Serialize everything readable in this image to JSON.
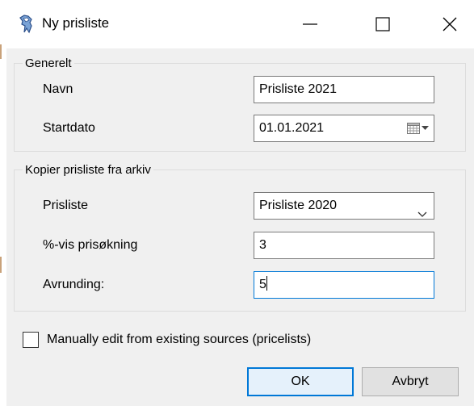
{
  "window": {
    "title": "Ny prisliste"
  },
  "general": {
    "group_title": "Generelt",
    "name_label": "Navn",
    "name_value": "Prisliste 2021",
    "startdate_label": "Startdato",
    "startdate_value": "01.01.2021"
  },
  "copy": {
    "group_title": "Kopier prisliste fra arkiv",
    "pricelist_label": "Prisliste",
    "pricelist_selected": "Prisliste 2020",
    "increase_label": "%-vis prisøkning",
    "increase_value": "3",
    "rounding_label": "Avrunding:",
    "rounding_value": "5"
  },
  "manual_edit": {
    "label": "Manually edit from existing sources (pricelists)",
    "checked": false
  },
  "buttons": {
    "ok_label": "OK",
    "cancel_label": "Avbryt"
  },
  "icons": {
    "app": "robot-app-icon",
    "minimize": "minimize-icon",
    "maximize": "maximize-icon",
    "close": "close-icon",
    "calendar": "calendar-icon",
    "dropdown": "chevron-down-icon"
  },
  "colors": {
    "dialog_bg": "#f0f0f0",
    "focus_border": "#0078d7",
    "button_bg": "#e1e1e1"
  }
}
